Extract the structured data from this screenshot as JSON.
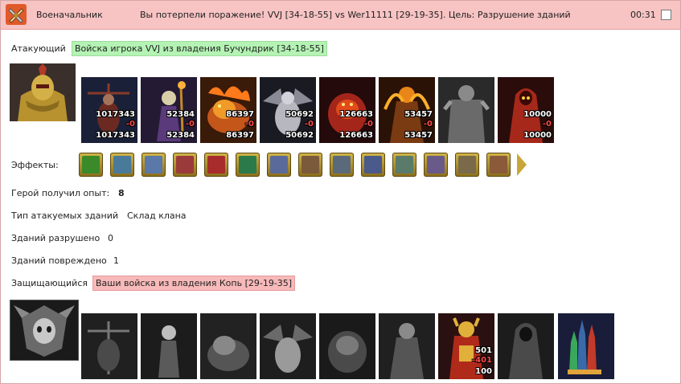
{
  "title": {
    "role": "Военачальник",
    "message": "Вы потерпели поражение! VVJ [34-18-55] vs Wer11111 [29-19-35]. Цель: Разрушение зданий",
    "time": "00:31"
  },
  "attacker": {
    "label": "Атакующий",
    "tag": "Войска игрока VVJ из владения Бучундрик [34-18-55]",
    "hero_icon": "golden-armored-hero",
    "units": [
      {
        "icon": "crossbow-warrior",
        "count": "1017343",
        "loss": "-0",
        "remaining": "1017343"
      },
      {
        "icon": "skeleton-mage",
        "count": "52384",
        "loss": "-0",
        "remaining": "52384"
      },
      {
        "icon": "fire-beast",
        "count": "86397",
        "loss": "-0",
        "remaining": "86397"
      },
      {
        "icon": "bone-dragon",
        "count": "50692",
        "loss": "-0",
        "remaining": "50692"
      },
      {
        "icon": "lava-golem",
        "count": "126663",
        "loss": "-0",
        "remaining": "126663"
      },
      {
        "icon": "fire-demon",
        "count": "53457",
        "loss": "-0",
        "remaining": "53457"
      },
      {
        "icon": "stone-golem",
        "count": "",
        "loss": "",
        "remaining": ""
      },
      {
        "icon": "flame-lich",
        "count": "10000",
        "loss": "-0",
        "remaining": "10000"
      }
    ]
  },
  "effects": {
    "label": "Эффекты:",
    "items": [
      {
        "icon": "sword-effect",
        "color": "#3a8a2a"
      },
      {
        "icon": "crossed-swords-effect",
        "color": "#4a7a9a"
      },
      {
        "icon": "hand-effect",
        "color": "#5a78a8"
      },
      {
        "icon": "chest-effect",
        "color": "#9a3a3a"
      },
      {
        "icon": "dice-effect",
        "color": "#a82c2c"
      },
      {
        "icon": "shield-effect",
        "color": "#2a7a4a"
      },
      {
        "icon": "scroll-effect",
        "color": "#5a6a9a"
      },
      {
        "icon": "coins-effect",
        "color": "#7a5a3a"
      },
      {
        "icon": "tower-effect",
        "color": "#5a6a7a"
      },
      {
        "icon": "pentagram-effect",
        "color": "#4a5a8a"
      },
      {
        "icon": "armor-effect",
        "color": "#5a7a6a"
      },
      {
        "icon": "ring-effect",
        "color": "#6a5a8a"
      },
      {
        "icon": "claws-effect",
        "color": "#7a6a4a"
      },
      {
        "icon": "round-shield-effect",
        "color": "#8a5a3a"
      }
    ]
  },
  "stats": {
    "experience_label": "Герой получил опыт:",
    "experience_value": "8",
    "building_type_label": "Тип атакуемых зданий",
    "building_type_value": "Склад клана",
    "destroyed_label": "Зданий разрушено",
    "destroyed_value": "0",
    "damaged_label": "Зданий повреждено",
    "damaged_value": "1"
  },
  "defender": {
    "label": "Защищающийся",
    "tag": "Ваши войска из владения Копь [29-19-35]",
    "hero_icon": "demon-skull-emblem",
    "units": [
      {
        "icon": "grey-crossbow-warrior",
        "count": "",
        "loss": "",
        "remaining": ""
      },
      {
        "icon": "grey-skeleton",
        "count": "",
        "loss": "",
        "remaining": ""
      },
      {
        "icon": "grey-beast",
        "count": "",
        "loss": "",
        "remaining": ""
      },
      {
        "icon": "grey-bone-dragon",
        "count": "",
        "loss": "",
        "remaining": ""
      },
      {
        "icon": "grey-golem",
        "count": "",
        "loss": "",
        "remaining": ""
      },
      {
        "icon": "grey-warrior",
        "count": "",
        "loss": "",
        "remaining": ""
      },
      {
        "icon": "red-gold-demon",
        "count": "501",
        "loss": "-401",
        "remaining": "100"
      },
      {
        "icon": "grey-reaper",
        "count": "",
        "loss": "",
        "remaining": ""
      },
      {
        "icon": "spire-tower",
        "count": "",
        "loss": "",
        "remaining": ""
      }
    ]
  }
}
